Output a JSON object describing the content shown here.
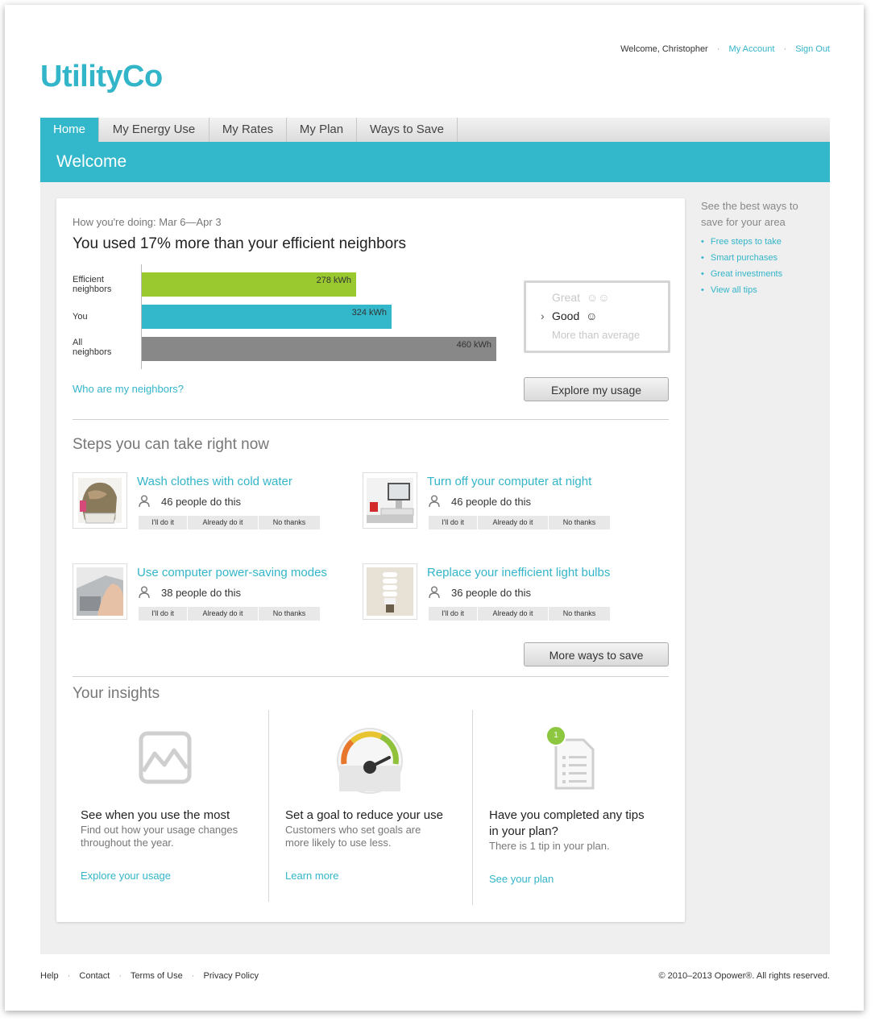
{
  "header": {
    "welcome": "Welcome, Christopher",
    "account_link": "My Account",
    "signout_link": "Sign Out",
    "logo": "UtilityCo"
  },
  "tabs": [
    "Home",
    "My Energy Use",
    "My Rates",
    "My Plan",
    "Ways to Save"
  ],
  "banner_title": "Welcome",
  "comparison": {
    "period": "How you're doing: Mar 6—Apr 3",
    "headline": "You used 17% more than your efficient neighbors",
    "rows": [
      {
        "label_1": "Efficient",
        "label_2": "neighbors",
        "value": 278,
        "value_label": "278 kWh",
        "color": "#99c92f"
      },
      {
        "label_1": "You",
        "label_2": "",
        "value": 324,
        "value_label": "324 kWh",
        "color": "#33b8cb"
      },
      {
        "label_1": "All",
        "label_2": "neighbors",
        "value": 460,
        "value_label": "460 kWh",
        "color": "#888888"
      }
    ],
    "neighbors_link": "Who are my neighbors?",
    "rating": {
      "great": "Great",
      "good": "Good",
      "more": "More than average"
    },
    "explore_button": "Explore my usage"
  },
  "steps": {
    "title": "Steps you can take right now",
    "items": [
      {
        "title": "Wash clothes with cold water",
        "people": "46 people do this"
      },
      {
        "title": "Turn off your computer at night",
        "people": "46 people do this"
      },
      {
        "title": "Use computer power-saving modes",
        "people": "38 people do this"
      },
      {
        "title": "Replace your inefficient light bulbs",
        "people": "36 people do this"
      }
    ],
    "actions": {
      "do": "I'll do it",
      "already": "Already do it",
      "no": "No thanks"
    },
    "more_button": "More ways to save"
  },
  "insights": {
    "title": "Your insights",
    "cards": [
      {
        "title_1": "See when you use the most",
        "title_2": "",
        "sub_1": "Find out how your usage changes",
        "sub_2": "throughout the year.",
        "link": "Explore your usage"
      },
      {
        "title_1": "Set a goal to reduce your use",
        "title_2": "",
        "sub_1": "Customers who set goals are",
        "sub_2": "more likely to use less.",
        "link": "Learn more"
      },
      {
        "title_1": "Have you completed any tips",
        "title_2": "in your plan?",
        "sub_1": "There is 1 tip in your plan.",
        "sub_2": "",
        "link": "See your plan"
      }
    ],
    "plan_badge": "1"
  },
  "sidebar": {
    "intro_1": "See the best ways to",
    "intro_2": "save for your area",
    "links": [
      "Free steps to take",
      "Smart purchases",
      "Great investments",
      "View all tips"
    ]
  },
  "footer": {
    "links": [
      "Help",
      "Contact",
      "Terms of Use",
      "Privacy Policy"
    ],
    "copyright": "© 2010–2013 Opower®. All rights reserved."
  }
}
